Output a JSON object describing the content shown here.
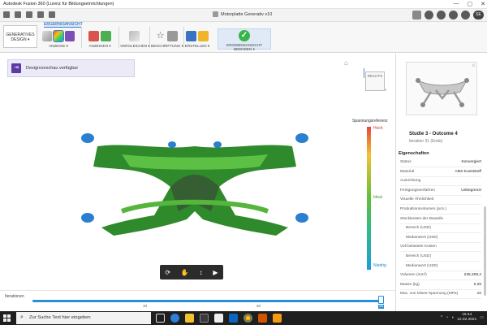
{
  "window": {
    "title": "Autodesk Fusion 360 (Lizenz für Bildungseinrichtungen)",
    "minimize": "—",
    "maximize": "▢",
    "close": "✕"
  },
  "doc_tab": {
    "title": "Motorplatte Generativ v10"
  },
  "avatar": "SE",
  "ribbon": {
    "workspace": "GENERATIVES DESIGN",
    "env_tab": "ERGEBNISANSICHT",
    "groups": {
      "anzeige": "ANZEIGE",
      "anzeigen": "ANZEIGEN",
      "vergleichen": "VERGLEICHEN",
      "beschriftung": "BESCHRIFTUNG",
      "erstellen": "ERSTELLEN",
      "finish": "ERGEBNISANSICHT BEENDEN"
    },
    "caret": "▾"
  },
  "banner": {
    "text": "Designvorschau verfügbar"
  },
  "viewcube": {
    "face": "RECHTS",
    "axis": "Y"
  },
  "legend": {
    "title": "Spannungsreferenz",
    "high": "Hoch",
    "ideal": "Ideal",
    "low": "Niedrig"
  },
  "timeline": {
    "label": "Iterationen",
    "ticks": [
      "10",
      "20"
    ],
    "current": "31"
  },
  "study": {
    "title": "Studie 3 - Outcome 4",
    "subtitle": "Iteration 31 (Ende)"
  },
  "properties": {
    "heading": "Eigenschaften",
    "rows": [
      {
        "label": "Status",
        "value": "Konvergiert"
      },
      {
        "label": "Material",
        "value": "ABS-Kunststoff"
      },
      {
        "label": "Ausrichtung",
        "value": ""
      },
      {
        "label": "Fertigungsverfahren",
        "value": "Unbegrenzt"
      },
      {
        "label": "Visuelle Ähnlichkeit",
        "value": ""
      },
      {
        "label": "Produktionsvolumen (pcs.)",
        "value": ""
      },
      {
        "label": "Stückkosten der Bauteile",
        "value": ""
      },
      {
        "label": "Bereich (USD)",
        "value": "",
        "indent": true
      },
      {
        "label": "Medianwert (USD)",
        "value": "",
        "indent": true
      },
      {
        "label": "Voll belastete Kosten",
        "value": ""
      },
      {
        "label": "Bereich (USD)",
        "value": "",
        "indent": true
      },
      {
        "label": "Medianwert (USD)",
        "value": "",
        "indent": true
      },
      {
        "label": "Volumen (mm³)",
        "value": "245.208,2"
      },
      {
        "label": "Masse (kg)",
        "value": "0.26"
      },
      {
        "label": "Max. von Mises-Spannung (MPa)",
        "value": "10"
      }
    ]
  },
  "taskbar": {
    "search_placeholder": "Zur Suche Text hier eingeben",
    "time": "15:44",
    "date": "12.02.2021"
  },
  "colors": {
    "accent": "#2a8fd8",
    "model_green": "#2f8a2b",
    "model_blue": "#2a7fd0",
    "finish_check": "#37b54a"
  }
}
